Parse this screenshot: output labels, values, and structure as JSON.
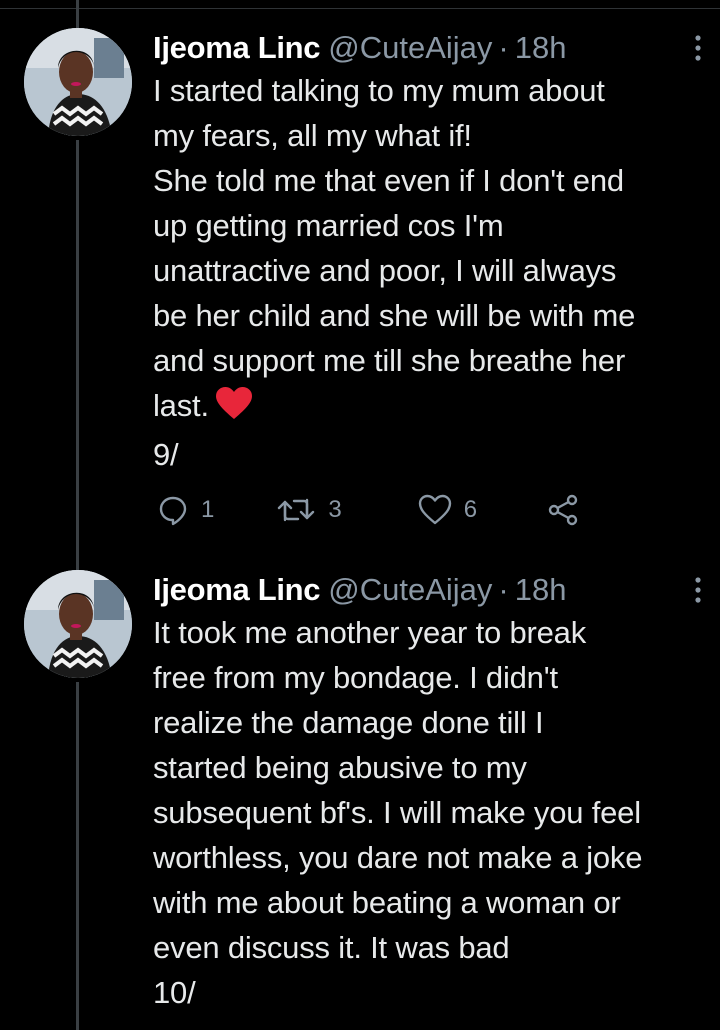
{
  "tweets": [
    {
      "display_name": "Ijeoma Linc",
      "handle": "@CuteAijay",
      "separator": "·",
      "time": "18h",
      "text_lines": [
        "I started talking to my mum about",
        "my fears, all my what if!",
        "She told me that even if I don't end",
        "up getting married cos I'm",
        "unattractive and poor, I will always",
        "be her child and she will be with me",
        "and support me till she breathe her",
        "last."
      ],
      "emoji": "red-heart-icon",
      "counter_line": "9/",
      "actions": {
        "replies": "1",
        "retweets": "3",
        "likes": "6"
      }
    },
    {
      "display_name": "Ijeoma Linc",
      "handle": "@CuteAijay",
      "separator": "·",
      "time": "18h",
      "text_lines": [
        "It took me another year to break",
        "free from my bondage. I didn't",
        "realize the damage done till I",
        "started being abusive to my",
        "subsequent bf's. I will make you feel",
        "worthless, you dare not make a joke",
        "with me about beating a woman or",
        "even discuss it. It was bad",
        "10/"
      ]
    }
  ],
  "colors": {
    "background": "#000000",
    "text": "#e7e9ea",
    "secondary": "#8b98a5",
    "heart": "#e8263a",
    "thread_line": "#3a3f43"
  }
}
